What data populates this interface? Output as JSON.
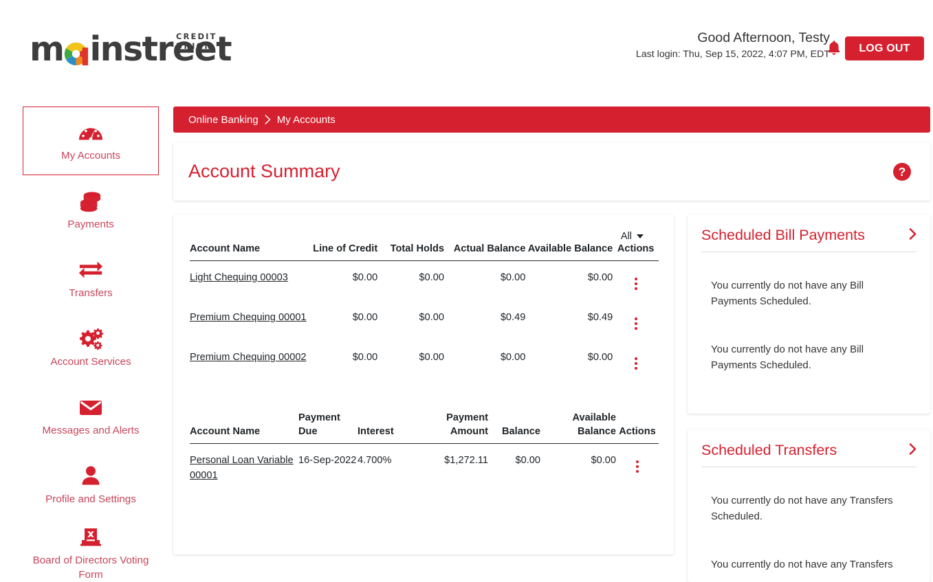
{
  "brand": {
    "logo_text": "mainstreet",
    "logo_tagline": "CREDIT UNION",
    "accent_red": "#D5202F",
    "link_red": "#C8455A"
  },
  "header": {
    "greeting": "Good Afternoon, Testy",
    "last_login": "Last login: Thu, Sep 15, 2022, 4:07 PM, EDT",
    "notifications_icon": "bell-icon",
    "logout_label": "LOG OUT"
  },
  "sidebar": {
    "items": [
      {
        "label": "My Accounts",
        "icon": "gauge-icon",
        "active": true
      },
      {
        "label": "Payments",
        "icon": "coins-icon",
        "active": false
      },
      {
        "label": "Transfers",
        "icon": "exchange-arrows-icon",
        "active": false
      },
      {
        "label": "Account Services",
        "icon": "gears-icon",
        "active": false
      },
      {
        "label": "Messages and Alerts",
        "icon": "envelope-icon",
        "active": false
      },
      {
        "label": "Profile and Settings",
        "icon": "user-icon",
        "active": false
      },
      {
        "label": "Board of Directors Voting Form",
        "icon": "ballot-box-icon",
        "active": false
      }
    ]
  },
  "breadcrumb": {
    "root": "Online Banking",
    "separator": "›",
    "current": "My Accounts"
  },
  "main": {
    "page_title": "Account Summary",
    "help_icon": "question-mark-circle-icon",
    "filter": {
      "selected": "All",
      "options": [
        "All"
      ]
    },
    "deposit_table": {
      "headers": [
        "Account Name",
        "Line of Credit",
        "Total Holds",
        "Actual Balance",
        "Available Balance",
        "Actions"
      ],
      "rows": [
        {
          "account_name": "Light Chequing 00003",
          "line_of_credit": "$0.00",
          "total_holds": "$0.00",
          "actual_balance": "$0.00",
          "available_balance": "$0.00",
          "actions_icon": "kebab-menu-icon"
        },
        {
          "account_name": "Premium Chequing 00001",
          "line_of_credit": "$0.00",
          "total_holds": "$0.00",
          "actual_balance": "$0.49",
          "available_balance": "$0.49",
          "actions_icon": "kebab-menu-icon"
        },
        {
          "account_name": "Premium Chequing 00002",
          "line_of_credit": "$0.00",
          "total_holds": "$0.00",
          "actual_balance": "$0.00",
          "available_balance": "$0.00",
          "actions_icon": "kebab-menu-icon"
        }
      ]
    },
    "loan_table": {
      "headers": [
        "Account Name",
        "Payment Due",
        "Interest",
        "Payment Amount",
        "Balance",
        "Available Balance",
        "Actions"
      ],
      "rows": [
        {
          "account_name": "Personal Loan Variable 00001",
          "payment_due": "16-Sep-2022",
          "interest": "4.700%",
          "payment_amount": "$1,272.11",
          "balance": "$0.00",
          "available_balance": "$0.00",
          "actions_icon": "kebab-menu-icon"
        }
      ]
    }
  },
  "panels": {
    "bill_payments": {
      "title": "Scheduled Bill Payments",
      "chevron": "›",
      "message_1": "You currently do not have any Bill Payments Scheduled.",
      "message_2": "You currently do not have any Bill Payments Scheduled."
    },
    "transfers": {
      "title": "Scheduled Transfers",
      "chevron": "›",
      "message_1": "You currently do not have any Transfers Scheduled.",
      "message_2": "You currently do not have any Transfers"
    }
  }
}
